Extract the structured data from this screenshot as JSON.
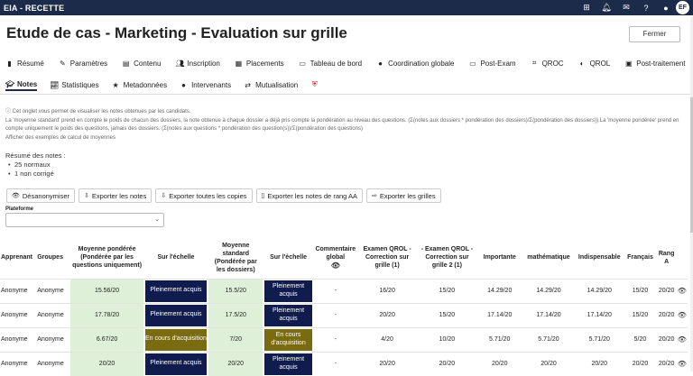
{
  "topbar": {
    "app_title": "EIA - RECETTE",
    "icons": [
      "windows-icon",
      "bell-icon",
      "mail-icon",
      "help-icon",
      "user-icon"
    ],
    "avatar": "EF"
  },
  "page": {
    "title": "Etude de cas - Marketing - Evaluation sur grille",
    "close_label": "Fermer"
  },
  "tabs_row1": [
    {
      "label": "Résumé",
      "icon": "bookmark-icon"
    },
    {
      "label": "Paramètres",
      "icon": "wrench-icon"
    },
    {
      "label": "Contenu",
      "icon": "book-icon"
    },
    {
      "label": "Inscription",
      "icon": "users-icon"
    },
    {
      "label": "Placements",
      "icon": "grid-icon"
    },
    {
      "label": "Tableau de bord",
      "icon": "easel-icon"
    },
    {
      "label": "Coordination globale",
      "icon": "globe-icon"
    },
    {
      "label": "Post-Exam",
      "icon": "tag-icon"
    },
    {
      "label": "QROC",
      "icon": "qrcode-icon"
    },
    {
      "label": "QROL",
      "icon": "compass-icon"
    },
    {
      "label": "Post-traitement",
      "icon": "monitor-icon"
    }
  ],
  "tabs_row2": [
    {
      "label": "Notes",
      "icon": "graduation-cap-icon",
      "active": true
    },
    {
      "label": "Statistiques",
      "icon": "line-chart-icon"
    },
    {
      "label": "Metadonnées",
      "icon": "star-icon"
    },
    {
      "label": "Intervenants",
      "icon": "person-icon"
    },
    {
      "label": "Mutualisation",
      "icon": "swap-icon"
    },
    {
      "label": "",
      "icon": "shield-icon"
    }
  ],
  "info": {
    "line1": "Cet onglet vous permet de visualiser les notes obtenues par les candidats.",
    "line2": "La 'moyenne standard' prend en compte le poids de chacun des dossiers, la note obtenue à chaque dossier a déjà pris compte la pondération au niveau des questions. (Σ(notes aux dossiers * pondération des dossiers)/Σ(pondération des dossiers)).La 'moyenne pondérée' prend en compte uniquement le poids des questions, jamais des dossiers. (Σ(notes aux questions * pondération des question(s))/Σ(pondération des questions)",
    "line3": "Afficher des exemples de calcul de moyennes"
  },
  "resume": {
    "label": "Résumé des notes :",
    "items": [
      "25 normaux",
      "1 non corrigé"
    ]
  },
  "actions": [
    {
      "label": "Désanonymiser",
      "icon": "eye-icon"
    },
    {
      "label": "Exporter les notes",
      "icon": "download-icon"
    },
    {
      "label": "Exporter toutes les copies",
      "icon": "download-icon"
    },
    {
      "label": "Exporter les notes de rang AA",
      "icon": "file-icon"
    },
    {
      "label": "Exporter les grilles",
      "icon": "export-icon"
    }
  ],
  "platform": {
    "label": "Plateforme",
    "value": ""
  },
  "table": {
    "headers": {
      "apprenant": "Apprenant",
      "groupes": "Groupes",
      "moy_pond": "Moyenne pondérée (Pondérée par les questions uniquement)",
      "echelle1": "Sur l'échelle",
      "moy_std": "Moyenne standard (Pondérée par les dossiers)",
      "echelle2": "Sur l'échelle",
      "commentaire": "Commentaire global",
      "examen1": "Examen QROL - Correction sur grille (1)",
      "examen2": "- Examen QROL - Correction sur grille 2 (1)",
      "importante": "Importante",
      "math": "mathématique",
      "indispensable": "Indispensable",
      "francais": "Français",
      "rang": "Rang A"
    },
    "rows": [
      {
        "apprenant": "Anonyme",
        "groupes": "Anonyme",
        "moy_pond": "15.56/20",
        "echelle1": "Pleinement acquis",
        "moy_std": "15.5/20",
        "echelle2": "Pleinement acquis",
        "commentaire": "-",
        "examen1": "16/20",
        "examen2": "15/20",
        "importante": "14.29/20",
        "math": "14.29/20",
        "indispensable": "14.29/20",
        "francais": "15/20",
        "rang": "20/20"
      },
      {
        "apprenant": "Anonyme",
        "groupes": "Anonyme",
        "moy_pond": "17.78/20",
        "echelle1": "Pleinement acquis",
        "moy_std": "17.5/20",
        "echelle2": "Pleinement acquis",
        "commentaire": "-",
        "examen1": "20/20",
        "examen2": "15/20",
        "importante": "17.14/20",
        "math": "17.14/20",
        "indispensable": "17.14/20",
        "francais": "15/20",
        "rang": "20/20"
      },
      {
        "apprenant": "Anonyme",
        "groupes": "Anonyme",
        "moy_pond": "6.67/20",
        "echelle1": "En cours d'acquisition",
        "moy_std": "7/20",
        "echelle2": "En cours d'acquisition",
        "commentaire": "-",
        "examen1": "4/20",
        "examen2": "10/20",
        "importante": "5.71/20",
        "math": "5.71/20",
        "indispensable": "5.71/20",
        "francais": "5/20",
        "rang": "20/20"
      },
      {
        "apprenant": "Anonyme",
        "groupes": "Anonyme",
        "moy_pond": "20/20",
        "echelle1": "Pleinement acquis",
        "moy_std": "20/20",
        "echelle2": "Pleinement acquis",
        "commentaire": "-",
        "examen1": "20/20",
        "examen2": "20/20",
        "importante": "20/20",
        "math": "20/20",
        "indispensable": "20/20",
        "francais": "20/20",
        "rang": "20/20"
      }
    ]
  },
  "colors": {
    "navy": "#0f1c4d",
    "olive": "#7a6a10",
    "green_cell": "#dff0d8",
    "topbar": "#1c2b4a"
  }
}
